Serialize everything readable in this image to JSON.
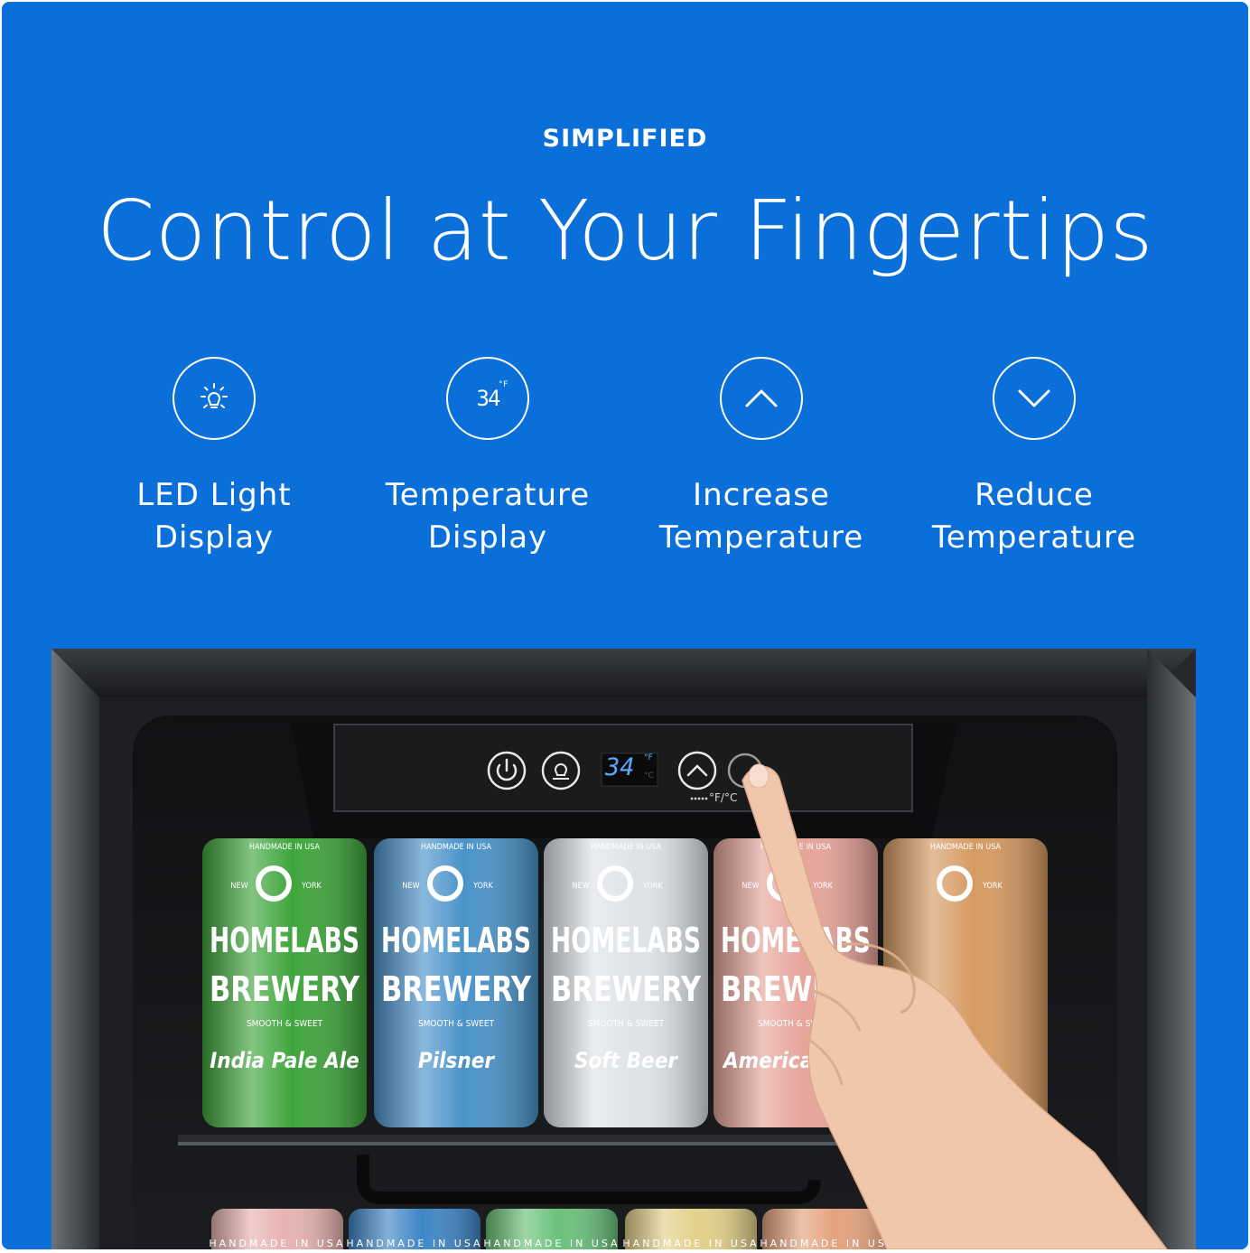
{
  "eyebrow": "SIMPLIFIED",
  "headline": "Control at Your Fingertips",
  "features": [
    {
      "icon": "light-bulb-icon",
      "line1": "LED Light",
      "line2": "Display"
    },
    {
      "icon": "temperature-readout-icon",
      "line1": "Temperature",
      "line2": "Display",
      "readout": "34",
      "unit": "°F"
    },
    {
      "icon": "chevron-up-icon",
      "line1": "Increase",
      "line2": "Temperature"
    },
    {
      "icon": "chevron-down-icon",
      "line1": "Reduce",
      "line2": "Temperature"
    }
  ],
  "control_panel": {
    "temperature": "34",
    "unit_f": "°F",
    "unit_c": "°C",
    "unit_toggle": "°F/°C"
  },
  "cans": [
    {
      "top": "HANDMADE IN USA",
      "left": "NEW",
      "right": "YORK",
      "brand": "HOMELABS",
      "sub": "BREWERY",
      "tag": "SMOOTH & SWEET",
      "style": "India Pale Ale",
      "color": "#3fa53c"
    },
    {
      "top": "HANDMADE IN USA",
      "left": "NEW",
      "right": "YORK",
      "brand": "HOMELABS",
      "sub": "BREWERY",
      "tag": "SMOOTH & SWEET",
      "style": "Pilsner",
      "color": "#4a93c9"
    },
    {
      "top": "HANDMADE IN USA",
      "left": "NEW",
      "right": "YORK",
      "brand": "HOMELABS",
      "sub": "BREWERY",
      "tag": "SMOOTH & SWEET",
      "style": "Soft Beer",
      "color": "#dfe3e7"
    },
    {
      "top": "HANDMADE IN USA",
      "left": "NEW",
      "right": "YORK",
      "brand": "HOMELABS",
      "sub": "BREWERY",
      "tag": "SMOOTH & SWEET",
      "style": "American Ipa",
      "color": "#e6a49a"
    },
    {
      "top": "HANDMADE IN USA",
      "left": "",
      "right": "YORK",
      "brand": "",
      "sub": "",
      "tag": "",
      "style": "",
      "color": "#d69a62"
    }
  ],
  "bottom_cans_text": "HANDMADE IN USA",
  "colors": {
    "background": "#0a6fd9",
    "text": "#ffffff"
  }
}
